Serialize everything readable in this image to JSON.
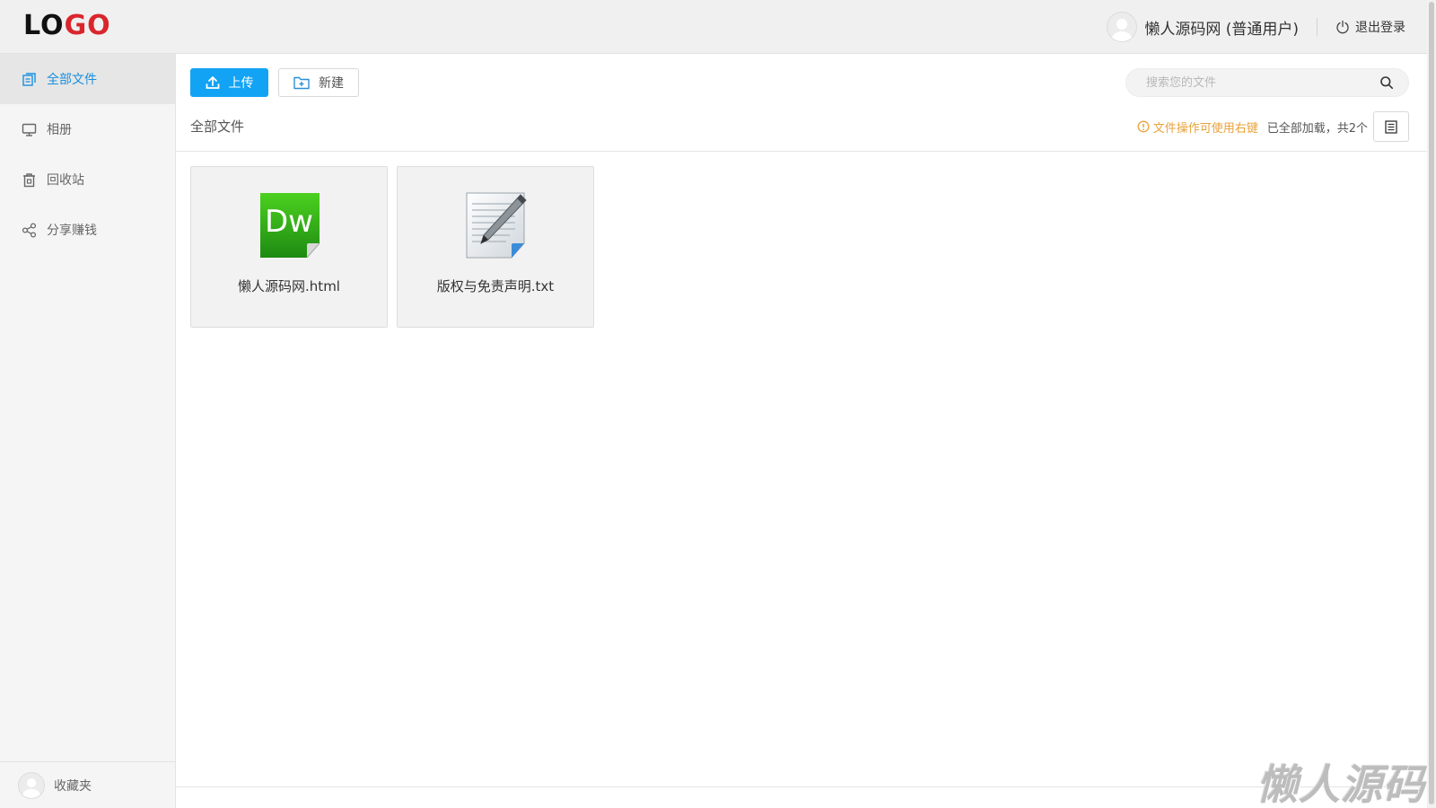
{
  "header": {
    "logo_part1": "LO",
    "logo_part2": "GO",
    "username": "懒人源码网 (普通用户)",
    "logout_label": "退出登录"
  },
  "sidebar": {
    "items": [
      {
        "label": "全部文件",
        "icon": "files-icon",
        "active": true
      },
      {
        "label": "相册",
        "icon": "monitor-icon",
        "active": false
      },
      {
        "label": "回收站",
        "icon": "trash-icon",
        "active": false
      },
      {
        "label": "分享赚钱",
        "icon": "share-icon",
        "active": false
      }
    ],
    "bottom_label": "收藏夹"
  },
  "toolbar": {
    "upload_label": "上传",
    "new_label": "新建"
  },
  "search": {
    "placeholder": "搜索您的文件"
  },
  "breadcrumb": "全部文件",
  "status": {
    "tip": "文件操作可使用右键",
    "loaded": "已全部加载，共2个"
  },
  "files": [
    {
      "name": "懒人源码网.html",
      "icon": "dreamweaver-file-icon"
    },
    {
      "name": "版权与免责声明.txt",
      "icon": "text-file-icon"
    }
  ],
  "watermark": "懒人源码",
  "colors": {
    "accent": "#13a3f5",
    "active_nav": "#1890e0",
    "tip": "#e8a23a",
    "logo_red": "#d9262c"
  }
}
